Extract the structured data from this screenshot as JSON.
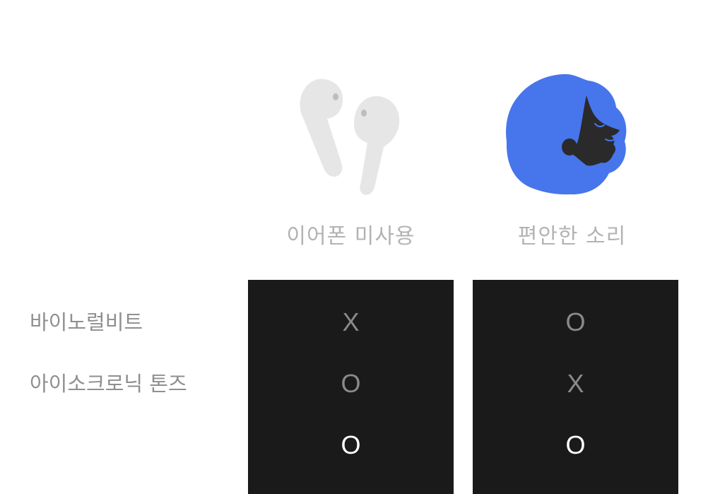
{
  "columns": [
    {
      "title": "이어폰 미사용",
      "icon": "earbuds-icon"
    },
    {
      "title": "편안한 소리",
      "icon": "relaxed-face-icon"
    }
  ],
  "rows": [
    {
      "label": "바이노럴비트",
      "values": [
        "X",
        "O"
      ]
    },
    {
      "label": "아이소크로닉 톤즈",
      "values": [
        "O",
        "X"
      ]
    },
    {
      "label": "",
      "values": [
        "O",
        "O"
      ]
    }
  ],
  "colors": {
    "blue_accent": "#4775eb",
    "earbud_gray": "#e6e6e6",
    "panel_dark": "#1a1a1a",
    "face_dark": "#2a2a2a"
  }
}
